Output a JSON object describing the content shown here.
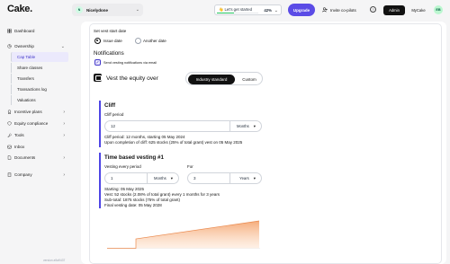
{
  "app": {
    "logo": "Cake."
  },
  "header": {
    "company": {
      "initials": "N",
      "name": "Nicelydone"
    },
    "progress": {
      "label": "👋 Let's get started",
      "percent_label": "42%",
      "value": 0.42
    },
    "upgrade_label": "Upgrade",
    "invite_label": "Invite co-pilots",
    "help_label": "?",
    "admin_label": "Admin",
    "mycake_label": "MyCake",
    "user_initials": "EB"
  },
  "sidebar": {
    "dashboard": "Dashboard",
    "ownership": "Ownership",
    "ownership_children": [
      "Cap Table",
      "Share classes",
      "Transfers",
      "Transactions log",
      "Valuations"
    ],
    "incentive_plans": "Incentive plans",
    "equity_compliance": "Equity compliance",
    "tools": "Tools",
    "inbox": "Inbox",
    "documents": "Documents",
    "company": "Company",
    "version": "version a9a9437"
  },
  "form": {
    "vest_start_label": "Set vest start date",
    "option_issue": "Issue date",
    "option_another": "Another date",
    "notifications_title": "Notifications",
    "notify_checkbox_label": "Send vesting notifications via email",
    "vest_equity_title": "Vest the equity over",
    "mode_standard": "Industry standard",
    "mode_custom": "Custom",
    "cliff": {
      "title": "Cliff",
      "period_label": "Cliff period",
      "value": "12",
      "unit": "Months",
      "summary_1": "Cliff period: 12 months, starting 05 May 2024",
      "summary_2": "Upon completion of cliff: 625 stocks (25% of total grant) vest on 05 May 2025"
    },
    "time_vesting": {
      "title": "Time based vesting #1",
      "every_label": "Vesting every period",
      "every_value": "1",
      "every_unit": "Months",
      "for_label": "For",
      "for_value": "3",
      "for_unit": "Years",
      "line_1": "Starting: 05 May 2025",
      "line_2": "Vest: 52 stocks (2.08% of total grant) every 1 months for 3 years",
      "line_3": "Sub-total: 1875 stocks (75% of total grant)",
      "line_4": "Final vesting date: 05 May 2028"
    }
  },
  "colors": {
    "accent": "#5b4ce6",
    "progress": "#22c55e",
    "chart": "#f4a26b"
  }
}
